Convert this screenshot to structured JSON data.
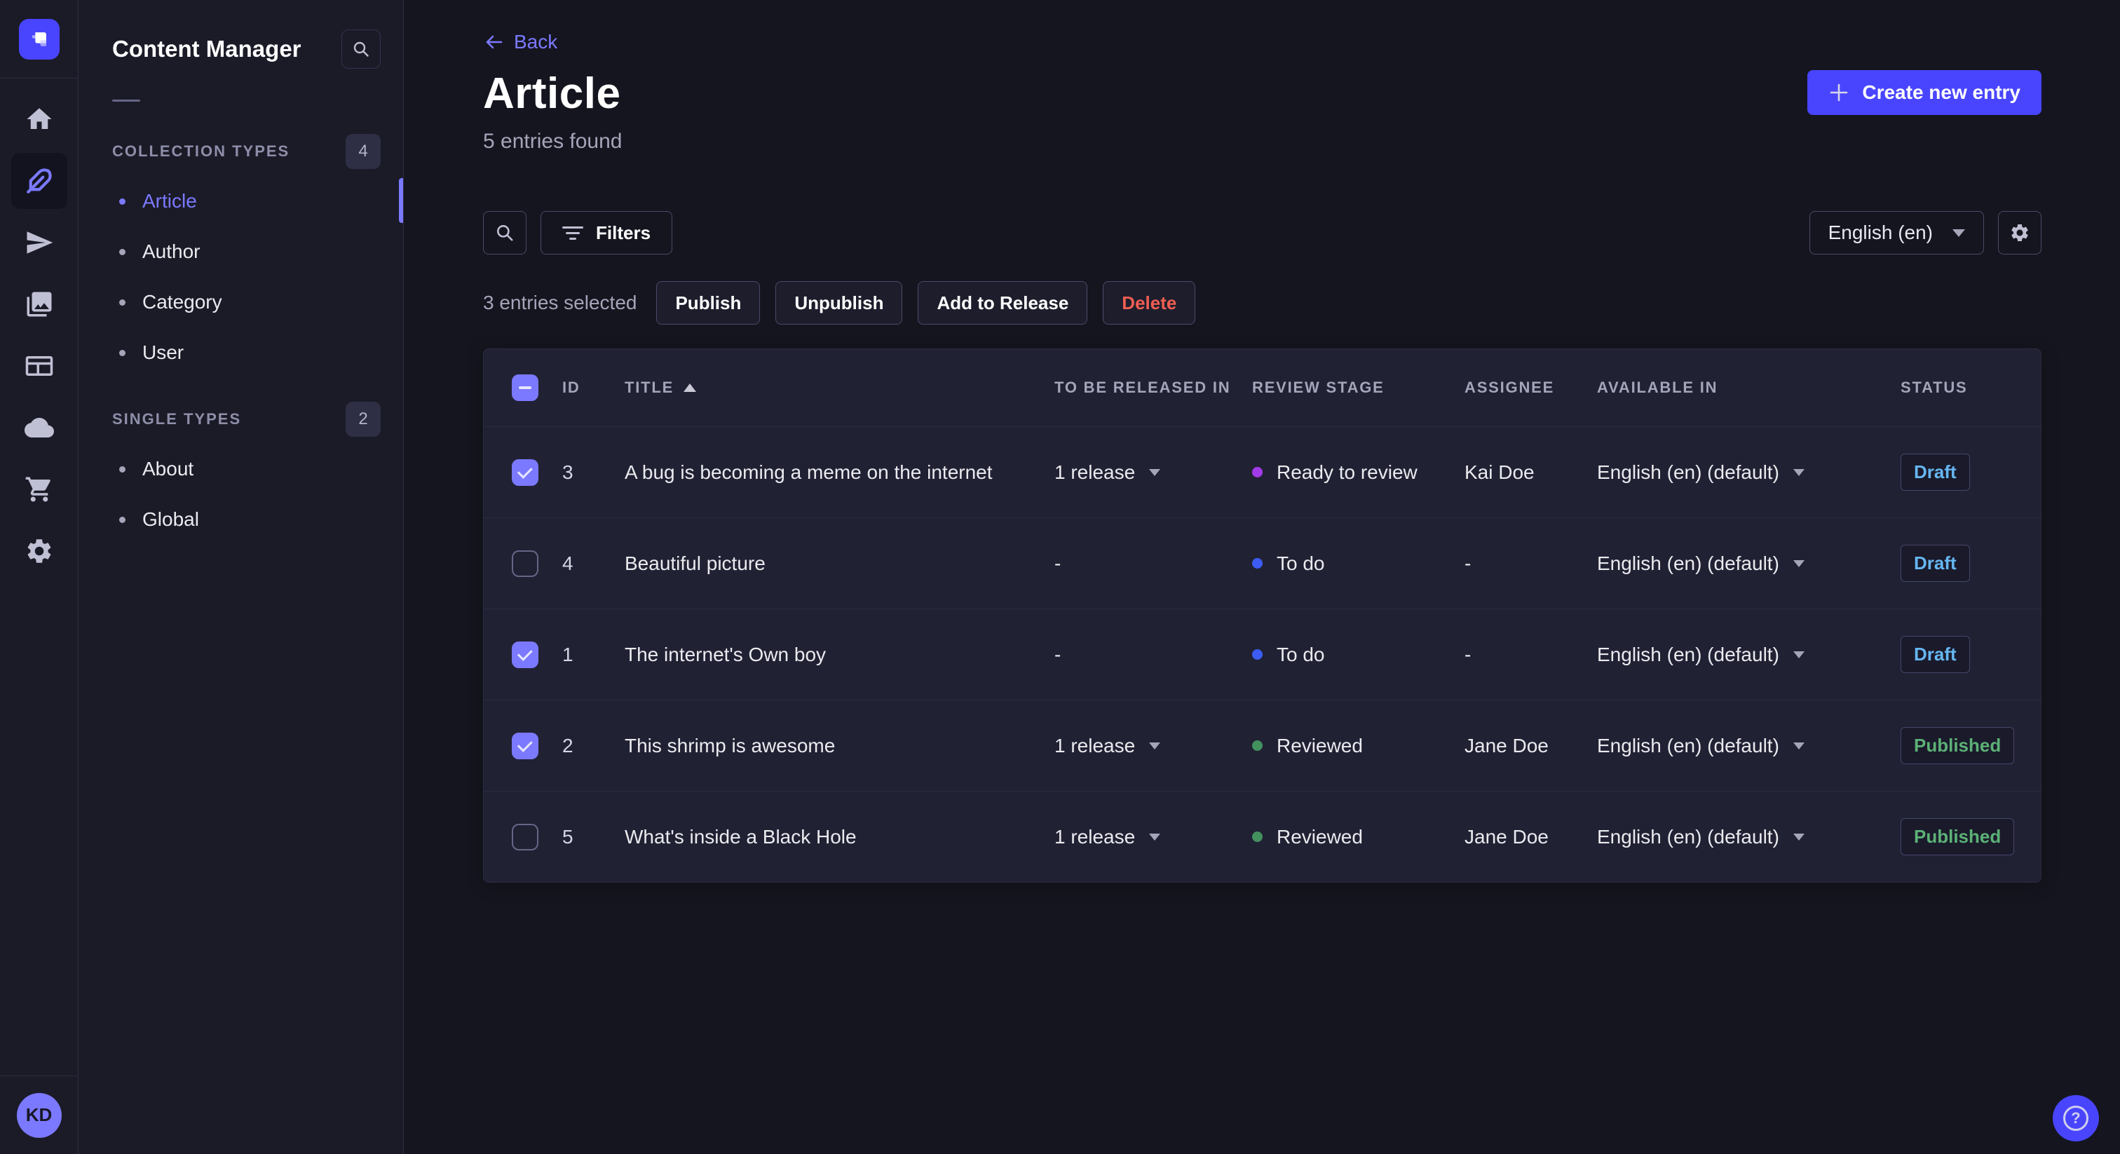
{
  "palette": {
    "accent": "#4945ff",
    "accent_light": "#7b79ff",
    "danger": "#ee5e52",
    "success": "#5cb176",
    "draft_blue": "#66b7f1",
    "dot_ready_to_review": "#a13be8",
    "dot_to_do": "#3c5cf5",
    "dot_reviewed": "#43915f"
  },
  "nav_rail": {
    "icons": [
      "home",
      "content-manager",
      "releases",
      "media-library",
      "content-type-builder",
      "deploy",
      "marketplace",
      "settings"
    ],
    "active_icon": "content-manager",
    "avatar_initials": "KD"
  },
  "sidebar": {
    "title": "Content Manager",
    "sections": [
      {
        "label": "COLLECTION TYPES",
        "count": "4",
        "items": [
          {
            "label": "Article",
            "active": true
          },
          {
            "label": "Author"
          },
          {
            "label": "Category"
          },
          {
            "label": "User"
          }
        ]
      },
      {
        "label": "SINGLE TYPES",
        "count": "2",
        "items": [
          {
            "label": "About"
          },
          {
            "label": "Global"
          }
        ]
      }
    ]
  },
  "header": {
    "back_label": "Back",
    "title": "Article",
    "subtitle": "5 entries found",
    "create_button_label": "Create new entry"
  },
  "toolbar": {
    "filters_label": "Filters",
    "locale_value": "English (en)"
  },
  "selection": {
    "text": "3 entries selected",
    "actions": [
      {
        "label": "Publish"
      },
      {
        "label": "Unpublish"
      },
      {
        "label": "Add to Release"
      },
      {
        "label": "Delete",
        "variant": "danger"
      }
    ]
  },
  "table": {
    "header_checkbox_state": "indeterminate",
    "columns": [
      "ID",
      "TITLE",
      "TO BE RELEASED IN",
      "REVIEW STAGE",
      "ASSIGNEE",
      "AVAILABLE IN",
      "STATUS"
    ],
    "sort_column": "TITLE",
    "sort_direction": "asc",
    "rows": [
      {
        "checked": true,
        "id": "3",
        "title": "A bug is becoming a meme on the internet",
        "release": "1 release",
        "release_expandable": true,
        "review_stage": "Ready to review",
        "review_dot_color": "#a13be8",
        "assignee": "Kai Doe",
        "available_in": "English (en) (default)",
        "status": "Draft",
        "status_color": "#66b7f1"
      },
      {
        "checked": false,
        "id": "4",
        "title": "Beautiful picture",
        "release": "-",
        "release_expandable": false,
        "review_stage": "To do",
        "review_dot_color": "#3c5cf5",
        "assignee": "-",
        "available_in": "English (en) (default)",
        "status": "Draft",
        "status_color": "#66b7f1"
      },
      {
        "checked": true,
        "id": "1",
        "title": "The internet's Own boy",
        "release": "-",
        "release_expandable": false,
        "review_stage": "To do",
        "review_dot_color": "#3c5cf5",
        "assignee": "-",
        "available_in": "English (en) (default)",
        "status": "Draft",
        "status_color": "#66b7f1"
      },
      {
        "checked": true,
        "id": "2",
        "title": "This shrimp is awesome",
        "release": "1 release",
        "release_expandable": true,
        "review_stage": "Reviewed",
        "review_dot_color": "#43915f",
        "assignee": "Jane Doe",
        "available_in": "English (en) (default)",
        "status": "Published",
        "status_color": "#5cb176"
      },
      {
        "checked": false,
        "id": "5",
        "title": "What's inside a Black Hole",
        "release": "1 release",
        "release_expandable": true,
        "review_stage": "Reviewed",
        "review_dot_color": "#43915f",
        "assignee": "Jane Doe",
        "available_in": "English (en) (default)",
        "status": "Published",
        "status_color": "#5cb176"
      }
    ]
  },
  "help": {
    "glyph": "?"
  }
}
